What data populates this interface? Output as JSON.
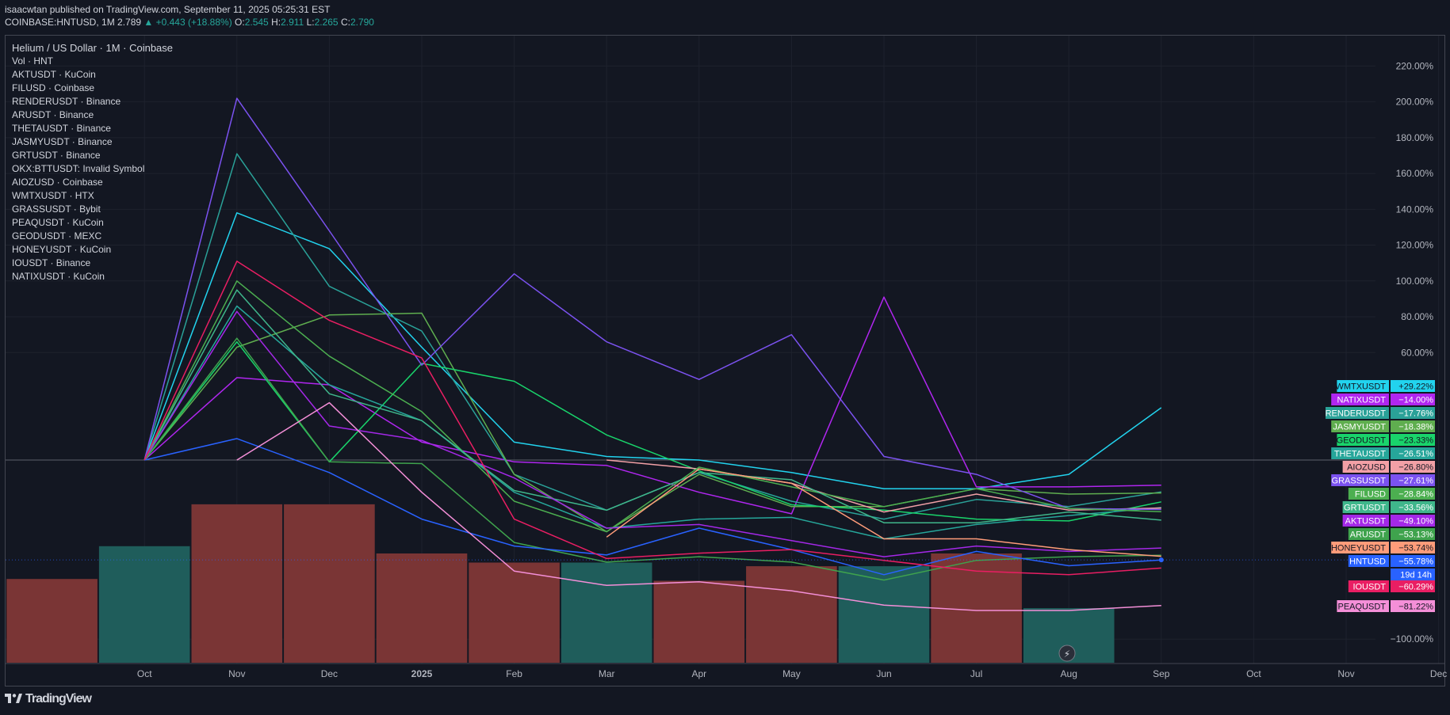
{
  "header": {
    "publisher": "isaacwtan published on TradingView.com, September 11, 2025 05:25:31 EST",
    "symbol": "COINBASE:HNTUSD, 1M",
    "last": "2.789",
    "change": "▲ +0.443 (+18.88%)",
    "o_label": "O:",
    "o": "2.545",
    "h_label": "H:",
    "h": "2.911",
    "l_label": "L:",
    "l": "2.265",
    "c_label": "C:",
    "c": "2.790"
  },
  "legend": {
    "title": "Helium / US Dollar · 1M · Coinbase",
    "items": [
      "Vol · HNT",
      "AKTUSDT · KuCoin",
      "FILUSD · Coinbase",
      "RENDERUSDT · Binance",
      "ARUSDT · Binance",
      "THETAUSDT · Binance",
      "JASMYUSDT · Binance",
      "GRTUSDT · Binance",
      "OKX:BTTUSDT: Invalid Symbol",
      "AIOZUSD · Coinbase",
      "WMTXUSDT · HTX",
      "GRASSUSDT · Bybit",
      "PEAQUSDT · KuCoin",
      "GEODUSDT · MEXC",
      "HONEYUSDT · KuCoin",
      "IOUSDT · Binance",
      "NATIXUSDT · KuCoin"
    ]
  },
  "footer": {
    "brand": "TradingView"
  },
  "chart_data": {
    "type": "line",
    "x": [
      "2024-09",
      "2024-10",
      "2024-11",
      "2024-12",
      "2025-01",
      "2025-02",
      "2025-03",
      "2025-04",
      "2025-05",
      "2025-06",
      "2025-07",
      "2025-08",
      "2025-09"
    ],
    "x_ticks": [
      "Oct",
      "Nov",
      "Dec",
      "2025",
      "Feb",
      "Mar",
      "Apr",
      "May",
      "Jun",
      "Jul",
      "Aug",
      "Sep",
      "Oct",
      "Nov",
      "Dec"
    ],
    "y_ticks": [
      "220.00%",
      "200.00%",
      "180.00%",
      "160.00%",
      "140.00%",
      "120.00%",
      "100.00%",
      "80.00%",
      "60.00%",
      "−100.00%"
    ],
    "y_tick_values": [
      220,
      200,
      180,
      160,
      140,
      120,
      100,
      80,
      60,
      -100
    ],
    "ylim": [
      -112,
      235
    ],
    "series": [
      {
        "name": "WMTXUSDT",
        "color": "#22d3ee",
        "label": "+29.22%",
        "values": [
          null,
          null,
          0,
          138,
          118,
          63,
          10,
          2,
          0,
          -7,
          -16,
          -16,
          -8,
          29.22
        ]
      },
      {
        "name": "NATIXUSDT",
        "color": "#b026f0",
        "label": "−14.00%",
        "values": [
          null,
          null,
          0,
          46,
          42,
          10,
          -1,
          -3,
          -18,
          -30,
          91,
          -15,
          -15,
          -14.0
        ]
      },
      {
        "name": "RENDERUSDT",
        "color": "#2aa198",
        "label": "−17.76%",
        "values": [
          null,
          null,
          0,
          171,
          97,
          72,
          -8,
          -28,
          -7,
          -23,
          -33,
          -22,
          -26,
          -17.76
        ]
      },
      {
        "name": "JASMYUSDT",
        "color": "#5fae4f",
        "label": "−18.38%",
        "values": [
          null,
          null,
          0,
          63,
          81,
          82,
          -8,
          -40,
          -8,
          -26,
          -26,
          -16,
          -19,
          -18.38
        ]
      },
      {
        "name": "GEODUSDT",
        "color": "#19d46b",
        "label": "−23.33%",
        "values": [
          null,
          null,
          0,
          66,
          -1,
          54,
          44,
          14,
          -6,
          -25,
          -28,
          -33,
          -34,
          -23.33
        ]
      },
      {
        "name": "THETAUSDT",
        "color": "#26a69a",
        "label": "−26.51%",
        "values": [
          null,
          null,
          0,
          86,
          42,
          22,
          -18,
          -38,
          -33,
          -32,
          -44,
          -36,
          -31,
          -26.51
        ]
      },
      {
        "name": "AIOZUSD",
        "color": "#f2a0a6",
        "label": "−26.80%",
        "values": [
          null,
          null,
          null,
          null,
          null,
          null,
          null,
          0,
          -5,
          -13,
          -29,
          -19,
          -28,
          -26.8
        ]
      },
      {
        "name": "GRASSUSDT",
        "color": "#7b52f0",
        "label": "−27.61%",
        "values": [
          null,
          null,
          0,
          202,
          128,
          53,
          104,
          66,
          45,
          70,
          2,
          -8,
          -27,
          -27.61
        ]
      },
      {
        "name": "FILUSD",
        "color": "#4caf50",
        "label": "−28.84%",
        "values": [
          null,
          null,
          0,
          100,
          58,
          27,
          -23,
          -40,
          -4,
          -15,
          -26,
          -16,
          -27,
          -28.84
        ]
      },
      {
        "name": "GRTUSDT",
        "color": "#3fb68b",
        "label": "−33.56%",
        "values": [
          null,
          null,
          0,
          95,
          37,
          22,
          -17,
          -28,
          -7,
          -11,
          -35,
          -35,
          -29,
          -33.56
        ]
      },
      {
        "name": "AKTUSDT",
        "color": "#a428e8",
        "label": "−49.10%",
        "values": [
          null,
          null,
          0,
          83,
          19,
          11,
          -10,
          -38,
          -36,
          -45,
          -54,
          -48,
          -51,
          -49.1
        ]
      },
      {
        "name": "ARUSDT",
        "color": "#3fa34d",
        "label": "−53.13%",
        "values": [
          null,
          null,
          0,
          68,
          -1,
          -2,
          -46,
          -57,
          -54,
          -57,
          -67,
          -56,
          -54,
          -53.13
        ]
      },
      {
        "name": "HONEYUSDT",
        "color": "#ff9c7a",
        "label": "−53.74%",
        "values": [
          null,
          null,
          null,
          null,
          null,
          null,
          null,
          -43,
          -5,
          -13,
          -44,
          -44,
          -50,
          -53.74
        ]
      },
      {
        "name": "HNTUSD",
        "color": "#2962ff",
        "label": "−55.78%",
        "values": [
          null,
          null,
          0,
          12,
          -7,
          -33,
          -48,
          -53,
          -38,
          -50,
          -64,
          -51,
          -59,
          -55.78
        ]
      },
      {
        "name": "IOUSDT",
        "color": "#e91e63",
        "label": "−60.29%",
        "values": [
          null,
          null,
          0,
          111,
          78,
          57,
          -33,
          -55,
          -52,
          -50,
          -56,
          -62,
          -64,
          -60.29
        ]
      },
      {
        "name": "PEAQUSDT",
        "color": "#f48fd8",
        "label": "−81.22%",
        "values": [
          null,
          null,
          null,
          0,
          32,
          -18,
          -62,
          -70,
          -68,
          -73,
          -81,
          -84,
          -84,
          -81.22
        ]
      }
    ],
    "extra_tag": "19d 14h",
    "volume": [
      {
        "value": 0.46,
        "up": false
      },
      {
        "value": 0.64,
        "up": true
      },
      {
        "value": 0.87,
        "up": false
      },
      {
        "value": 0.87,
        "up": false
      },
      {
        "value": 0.6,
        "up": false
      },
      {
        "value": 0.55,
        "up": false
      },
      {
        "value": 0.55,
        "up": true
      },
      {
        "value": 0.45,
        "up": false
      },
      {
        "value": 0.53,
        "up": false
      },
      {
        "value": 0.53,
        "up": true
      },
      {
        "value": 0.6,
        "up": false
      },
      {
        "value": 0.3,
        "up": true
      }
    ],
    "colors": {
      "background": "#131722",
      "grid": "#1e222d",
      "axis_text": "#b2b5be",
      "vol_up": "#1f5d5b",
      "vol_down": "#7a3535"
    }
  }
}
